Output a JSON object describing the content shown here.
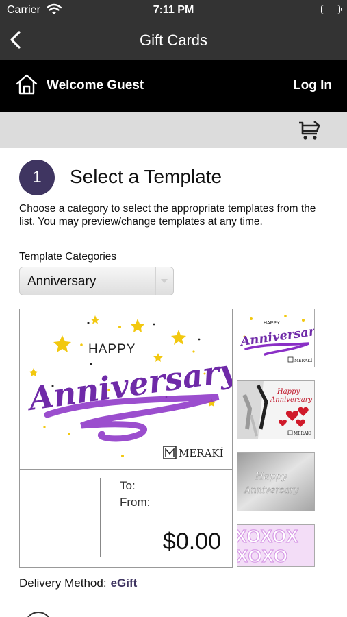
{
  "status_bar": {
    "carrier": "Carrier",
    "time": "7:11 PM"
  },
  "nav": {
    "title": "Gift Cards",
    "back_icon": "chevron-left-icon"
  },
  "header": {
    "welcome": "Welcome Guest",
    "login": "Log In",
    "home_icon": "home-icon",
    "cart_icon": "cart-icon"
  },
  "step": {
    "number": "1",
    "title": "Select a Template",
    "description": "Choose a category to select the appropriate templates from the list. You may preview/change templates at any time.",
    "categories_label": "Template Categories",
    "selected_category": "Anniversary"
  },
  "preview": {
    "greeting_small": "HAPPY",
    "greeting_large": "Anniversary!",
    "brand": "MERAKÍ",
    "to_label": "To:",
    "from_label": "From:",
    "amount": "$0.00"
  },
  "thumbnails": [
    {
      "name": "template-anniversary-script"
    },
    {
      "name": "template-anniversary-champagne",
      "text": "Happy Anniversary"
    },
    {
      "name": "template-anniversary-silver",
      "line1": "Happy",
      "line2": "Anniversary"
    },
    {
      "name": "template-xoxo",
      "line1": "XOXOX",
      "line2": "XOXO"
    }
  ],
  "delivery": {
    "label": "Delivery Method:",
    "method": "eGift"
  },
  "colors": {
    "accent": "#3f3561",
    "bar": "#333333",
    "header": "#000000",
    "strip": "#dcdcdc",
    "purple": "#8a2fc6"
  }
}
